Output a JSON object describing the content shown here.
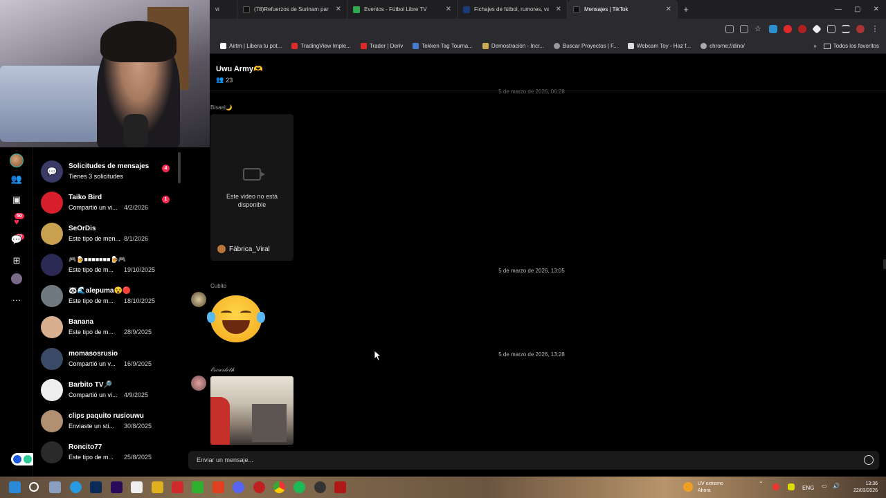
{
  "tabs": [
    {
      "label": "vi",
      "icon_color": "#555",
      "partial": true
    },
    {
      "label": "(78)Refuerzos de Surinam para",
      "icon": "tiktok-icon",
      "icon_color": "#111"
    },
    {
      "label": "Eventos - Fútbol Libre TV",
      "icon": "globe-icon",
      "icon_color": "#2fa84f"
    },
    {
      "label": "Fichajes de fútbol, rumores, val",
      "icon": "transfermarkt-icon",
      "icon_color": "#1a3a7a"
    },
    {
      "label": "Mensajes | TikTok",
      "icon": "tiktok-icon",
      "icon_color": "#111",
      "active": true
    }
  ],
  "bookmarks": [
    {
      "label": "Airtm | Libera tu pot...",
      "color": "#ffffff"
    },
    {
      "label": "TradingView Imple...",
      "color": "#e02a2a"
    },
    {
      "label": "Trader | Deriv",
      "color": "#e02a2a"
    },
    {
      "label": "Tekken Tag Tourna...",
      "color": "#4a7ad0"
    },
    {
      "label": "Demostración - Incr...",
      "color": "#ccaa55"
    },
    {
      "label": "Buscar Proyectos | F...",
      "color": "#999999"
    },
    {
      "label": "Webcam Toy - Haz f...",
      "color": "#dddddd"
    },
    {
      "label": "chrome://dino/",
      "color": "#aaaaaa"
    }
  ],
  "bookmarks_folder": "Todos los favoritos",
  "rail": {
    "badge_live": "50",
    "badge_messages": "28"
  },
  "conversations": [
    {
      "name": "Solicitudes de mensajes",
      "preview": "Tienes 3 solicitudes",
      "date": "",
      "badge": "4",
      "avatar_color": "#3a3a66"
    },
    {
      "name": "Taiko Bird",
      "preview": "Compartió un vi...",
      "date": "4/2/2026",
      "badge": "1",
      "avatar_color": "#d61f2b"
    },
    {
      "name": "SeOrDis",
      "preview": "Este tipo de men...",
      "date": "8/1/2026",
      "badge": "",
      "avatar_color": "#c8a050"
    },
    {
      "name": "🎮🍺■■■■■■■🍺🎮",
      "preview": "Este tipo de m...",
      "date": "19/10/2025",
      "badge": "",
      "avatar_color": "#2a2a55"
    },
    {
      "name": "🐼🌊alepuma😵🔴",
      "preview": "Este tipo de m...",
      "date": "18/10/2025",
      "badge": "",
      "avatar_color": "#6f7a80"
    },
    {
      "name": "Banana",
      "preview": "Este tipo de m...",
      "date": "28/9/2025",
      "badge": "",
      "avatar_color": "#d8b090"
    },
    {
      "name": "momasosrusio",
      "preview": "Compartió un v...",
      "date": "16/9/2025",
      "badge": "",
      "avatar_color": "#3a4a66"
    },
    {
      "name": "Barbito TV🔎",
      "preview": "Compartió un vi...",
      "date": "4/9/2025",
      "badge": "",
      "avatar_color": "#eeeeee"
    },
    {
      "name": "clips paquito rusiouwu",
      "preview": "Enviaste un sti...",
      "date": "30/8/2025",
      "badge": "",
      "avatar_color": "#b09070"
    },
    {
      "name": "Roncito77",
      "preview": "Este tipo de m...",
      "date": "25/8/2025",
      "badge": "",
      "avatar_color": "#2a2a2a"
    }
  ],
  "chat": {
    "title": "Uwu Army🫶",
    "members": "23",
    "timestamp_top": "5 de marzo de 2026, 06:28",
    "sender1": "Bisael🌙",
    "video_unavailable": "Este video no está disponible",
    "video_author": "Fàbrica_Viral",
    "timestamp2": "5 de marzo de 2026, 13:05",
    "sender2": "Cubito",
    "timestamp3": "5 de marzo de 2026, 13:28",
    "sender3": "𝓔𝓼𝓬𝓪𝓻𝓵𝓮𝓽𝓱",
    "composer_placeholder": "Enviar un mensaje..."
  },
  "taskbar": {
    "weather_title": "UV extremo",
    "weather_sub": "Ahora",
    "lang": "ENG",
    "time": "13:36",
    "date": "22/03/2026"
  }
}
